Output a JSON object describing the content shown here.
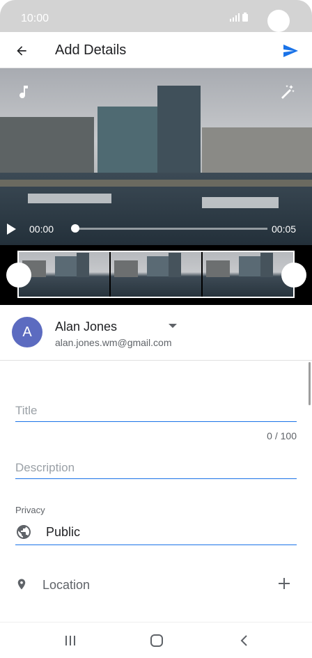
{
  "status_bar": {
    "time": "10:00",
    "icons": [
      "signal-icon",
      "battery-icon"
    ]
  },
  "app_bar": {
    "title": "Add Details",
    "back_icon": "arrow-back-icon",
    "send_icon": "send-icon"
  },
  "video": {
    "current_time": "00:00",
    "duration": "00:05",
    "progress": 0,
    "icons": [
      "music-note-icon",
      "magic-wand-icon",
      "play-icon"
    ]
  },
  "trim": {
    "thumbnail_count": 3
  },
  "account": {
    "avatar_letter": "A",
    "name": "Alan Jones",
    "email": "alan.jones.wm@gmail.com"
  },
  "form": {
    "title_placeholder": "Title",
    "title_value": "",
    "title_counter": "0 / 100",
    "description_placeholder": "Description",
    "description_value": "",
    "privacy_label": "Privacy",
    "privacy_value": "Public",
    "location_label": "Location"
  },
  "colors": {
    "accent": "#1a73e8",
    "avatar": "#5c6bc0"
  },
  "nav_bar": {
    "icons": [
      "recents-icon",
      "home-icon",
      "back-nav-icon"
    ]
  }
}
